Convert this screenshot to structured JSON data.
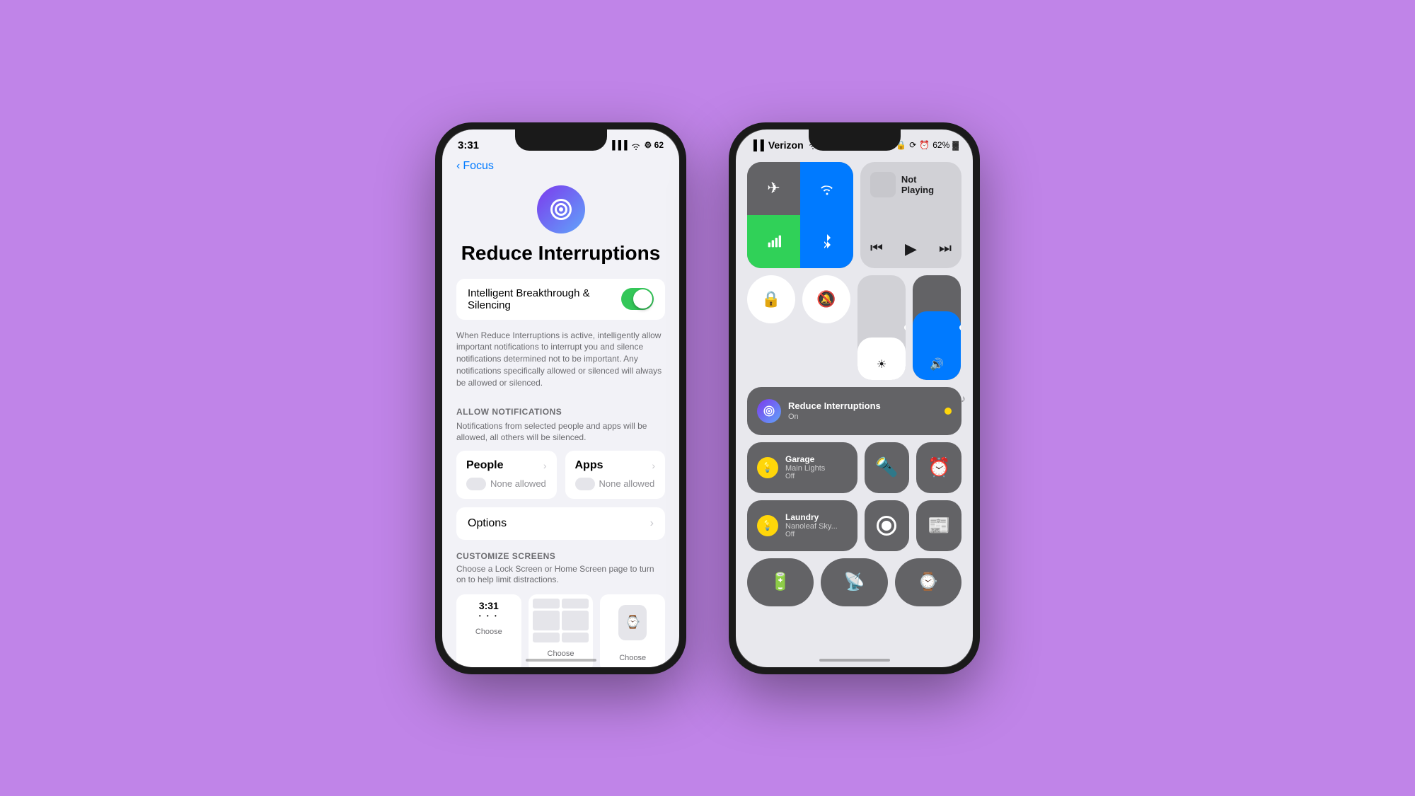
{
  "background_color": "#c084e8",
  "left_phone": {
    "status_bar": {
      "time": "3:31",
      "battery_icon": "⚙",
      "signal": "▐▐▐",
      "wifi": "wifi",
      "battery": "62"
    },
    "nav": {
      "back_label": "Focus"
    },
    "app_icon": "⚙️",
    "title": "Reduce Interruptions",
    "toggle": {
      "label": "Intelligent Breakthrough & Silencing",
      "state": "on"
    },
    "toggle_description": "When Reduce Interruptions is active, intelligently allow important notifications to interrupt you and silence notifications determined not to be important. Any notifications specifically allowed or silenced will always be allowed or silenced.",
    "allow_notifications": {
      "header": "ALLOW NOTIFICATIONS",
      "subtitle": "Notifications from selected people and apps will be allowed, all others will be silenced.",
      "people_label": "People",
      "people_sub": "None allowed",
      "apps_label": "Apps",
      "apps_sub": "None allowed"
    },
    "options": {
      "label": "Options"
    },
    "customize": {
      "header": "CUSTOMIZE SCREENS",
      "subtitle": "Choose a Lock Screen or Home Screen page to turn on to help limit distractions.",
      "choose_labels": [
        "Choose",
        "Choose",
        "Choose"
      ]
    }
  },
  "right_phone": {
    "status_bar": {
      "carrier": "Verizon",
      "battery_percent": "62%"
    },
    "connectivity": {
      "airplane": "✈",
      "wifi_active": true,
      "cellular": "📶",
      "bluetooth": "bluetooth"
    },
    "music": {
      "not_playing_label": "Not Playing"
    },
    "reduce_interruptions": {
      "label": "Reduce Interruptions On"
    },
    "tiles": {
      "lock": "🔒",
      "silent": "🔔",
      "garage_label": "Garage\nMain Lights\nOff",
      "flashlight": "🔦",
      "timer": "⏰",
      "laundry_label": "Laundry\nNanoleaf Sky...\nOff",
      "screen_record": "⏺",
      "news": "📰",
      "low_power": "🔋",
      "remote": "📡",
      "watch": "⌚"
    }
  }
}
